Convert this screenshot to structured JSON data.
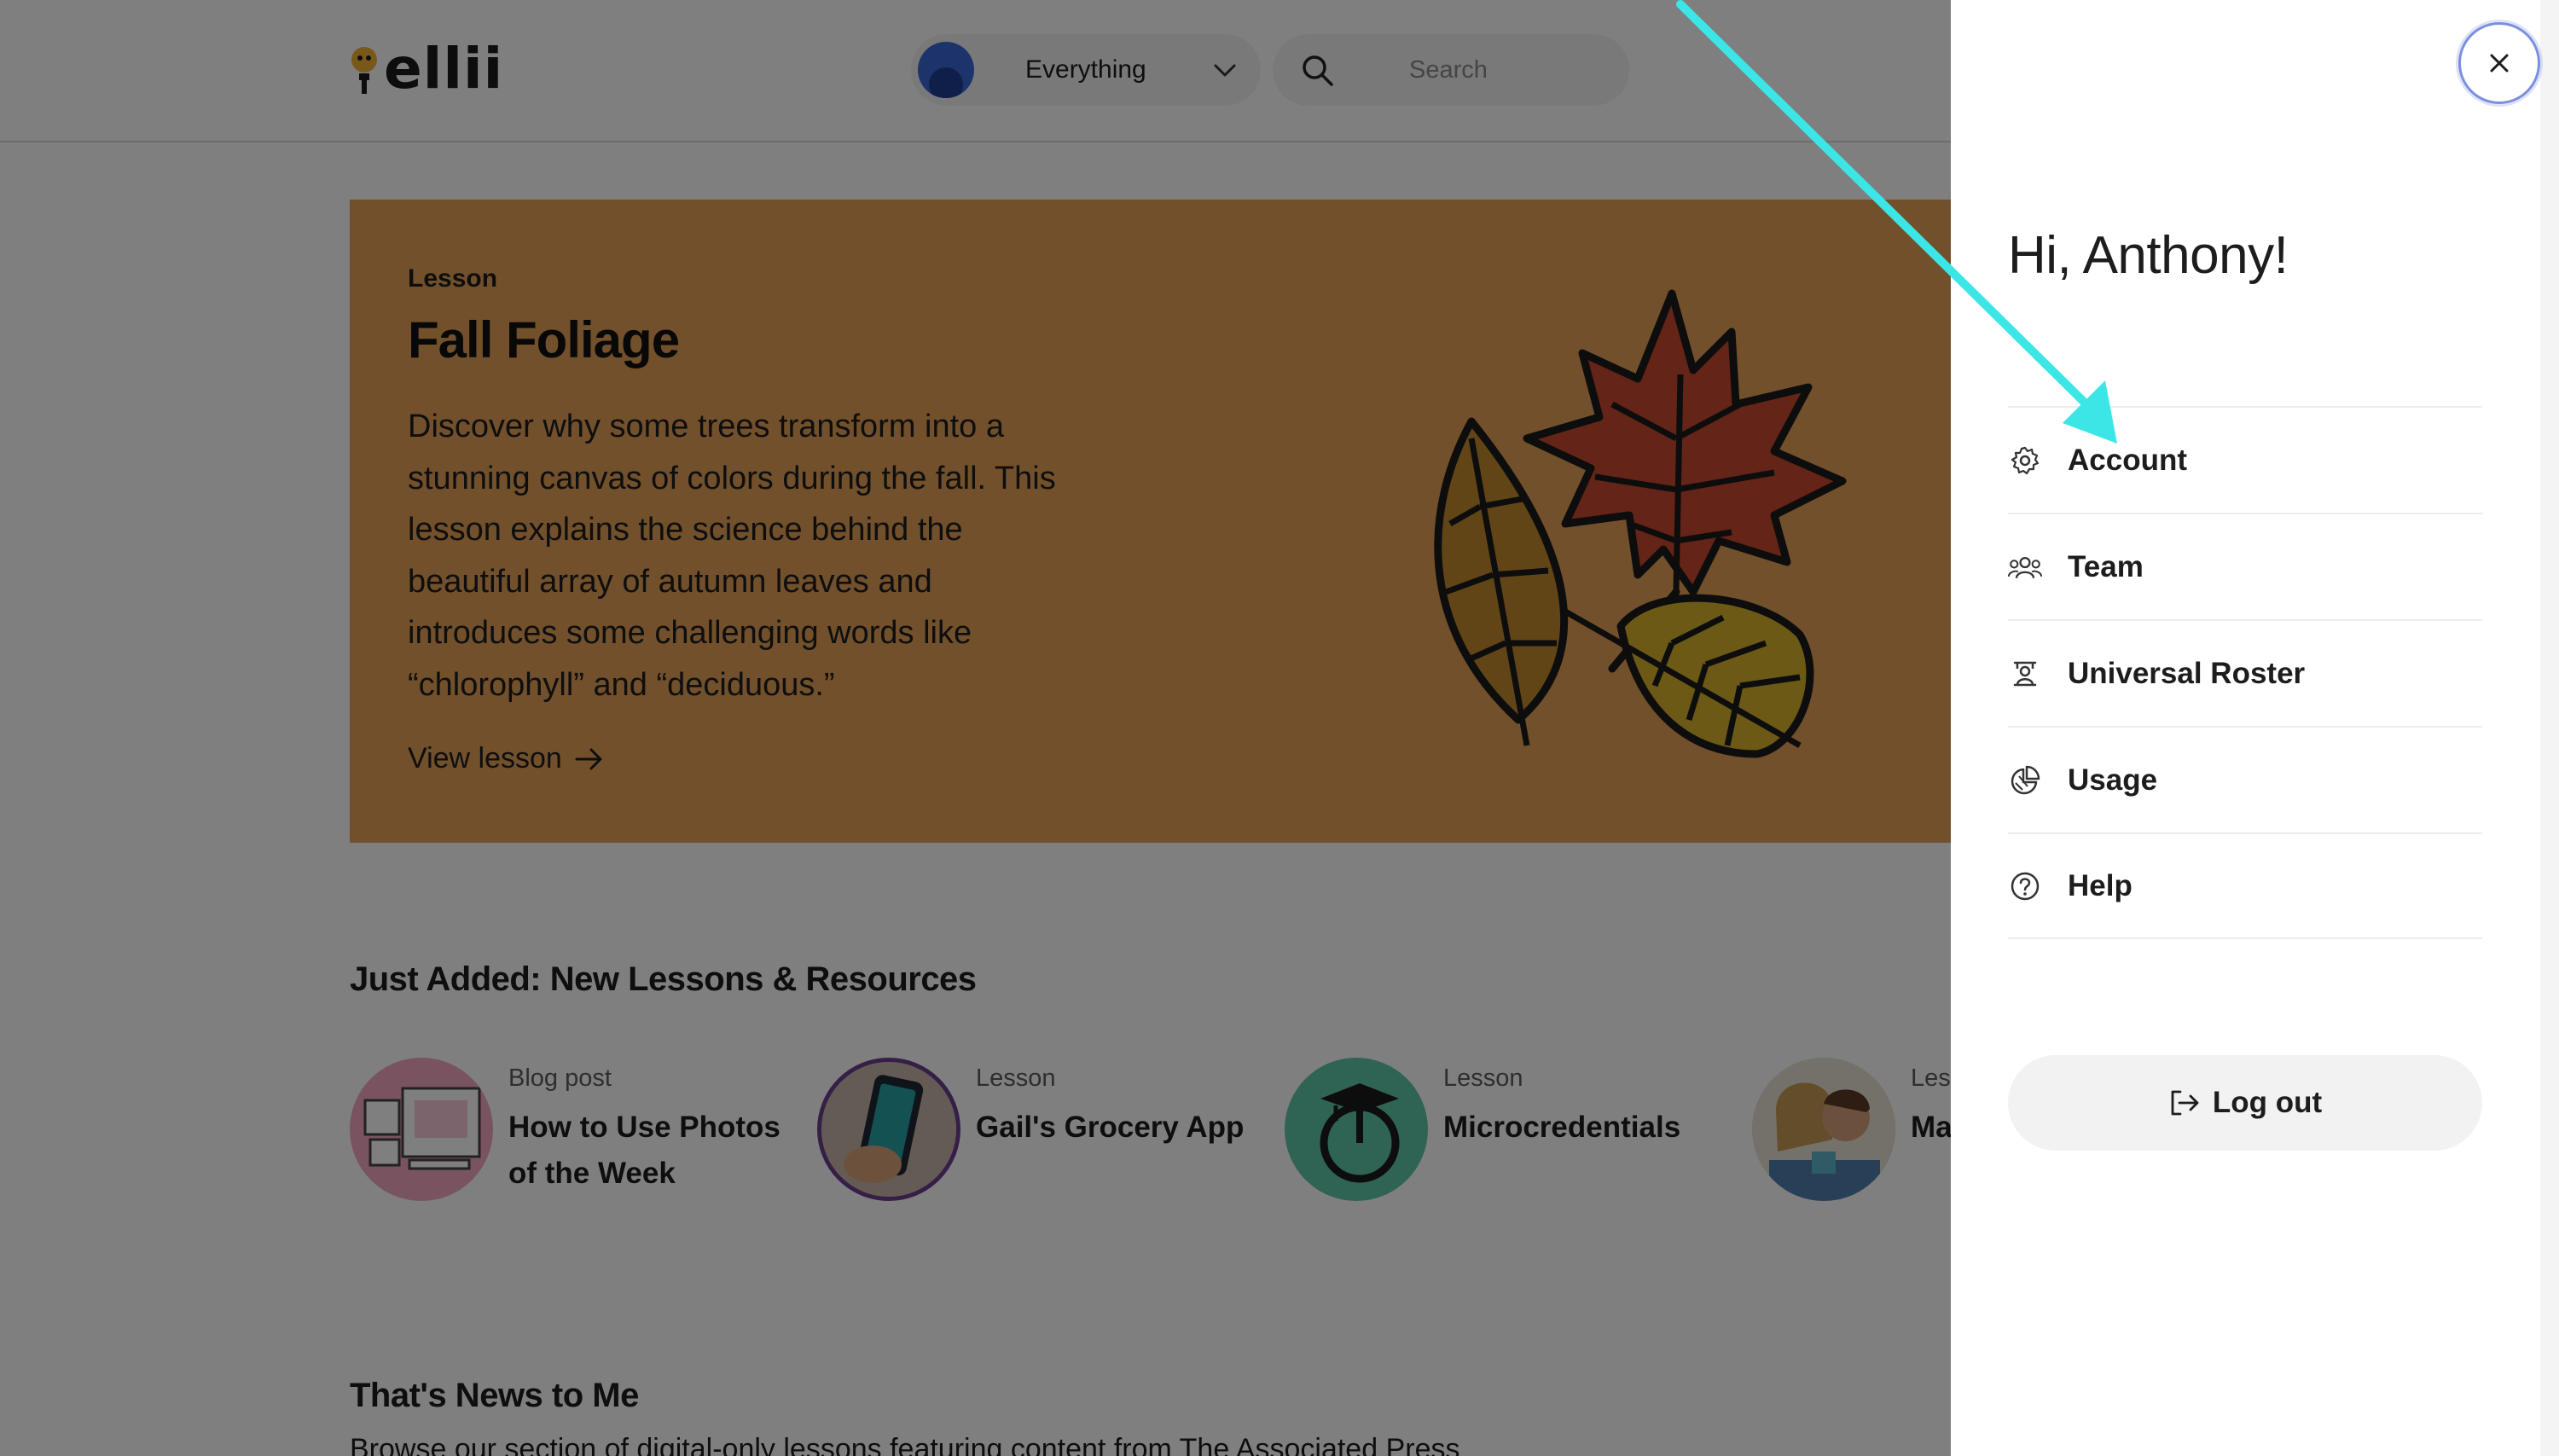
{
  "header": {
    "logo_text": "ellii",
    "filter_label": "Everything",
    "search_placeholder": "Search"
  },
  "hero": {
    "kicker": "Lesson",
    "title": "Fall Foliage",
    "description": "Discover why some trees transform into a stunning canvas of colors during the fall. This lesson explains the science behind the beautiful array of autumn leaves and introduces some challenging words like “chlorophyll” and “deciduous.”",
    "link_label": "View lesson"
  },
  "just_added": {
    "title": "Just Added: New Lessons & Resources",
    "items": [
      {
        "kicker": "Blog post",
        "title": "How to Use Photos of the Week"
      },
      {
        "kicker": "Lesson",
        "title": "Gail's Grocery App"
      },
      {
        "kicker": "Lesson",
        "title": "Microcredentials"
      },
      {
        "kicker": "Less",
        "title": "Ma"
      }
    ]
  },
  "news": {
    "title": "That's News to Me",
    "description": "Browse our section of digital-only lessons featuring content from The Associated Press"
  },
  "drawer": {
    "greeting": "Hi, Anthony!",
    "menu": [
      {
        "label": "Account",
        "icon": "gear-icon"
      },
      {
        "label": "Team",
        "icon": "team-icon"
      },
      {
        "label": "Universal Roster",
        "icon": "roster-icon"
      },
      {
        "label": "Usage",
        "icon": "usage-chart-icon"
      },
      {
        "label": "Help",
        "icon": "help-icon"
      }
    ],
    "logout_label": "Log out"
  },
  "colors": {
    "hero_bg": "#e3a156",
    "annotation_arrow": "#3de6e6",
    "overlay": "rgba(0,0,0,0.5)"
  }
}
